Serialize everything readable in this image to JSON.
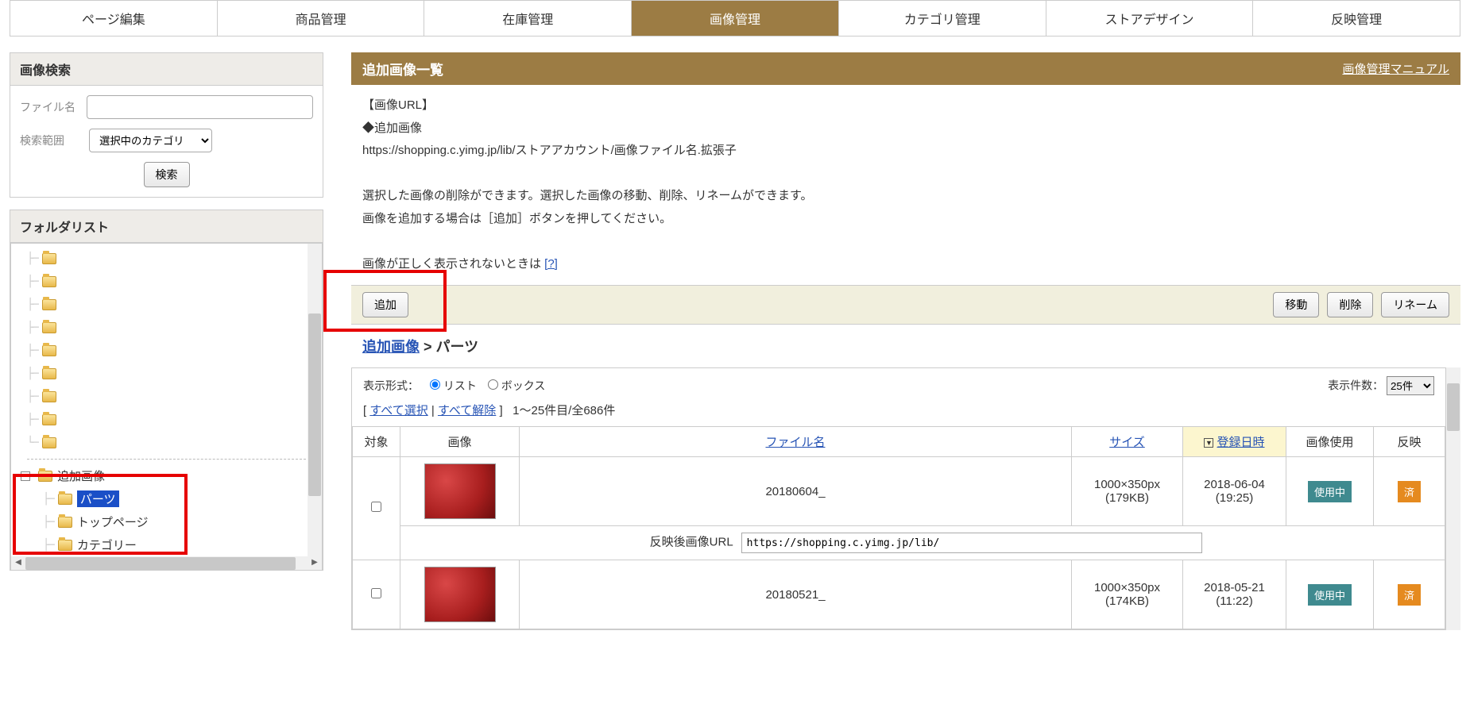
{
  "tabs": [
    "ページ編集",
    "商品管理",
    "在庫管理",
    "画像管理",
    "カテゴリ管理",
    "ストアデザイン",
    "反映管理"
  ],
  "activeTab": 3,
  "search": {
    "title": "画像検索",
    "filename_label": "ファイル名",
    "scope_label": "検索範囲",
    "scope_value": "選択中のカテゴリ",
    "button": "検索"
  },
  "folders": {
    "title": "フォルダリスト",
    "root_added": "追加画像",
    "children": [
      "パーツ",
      "トップページ",
      "カテゴリー"
    ],
    "selected_child": 0
  },
  "main": {
    "header_title": "追加画像一覧",
    "header_link": "画像管理マニュアル",
    "url_heading": "【画像URL】",
    "url_sub": "◆追加画像",
    "url_template": "https://shopping.c.yimg.jp/lib/ストアアカウント/画像ファイル名.拡張子",
    "desc1": "選択した画像の削除ができます。選択した画像の移動、削除、リネームができます。",
    "desc2": "画像を追加する場合は［追加］ボタンを押してください。",
    "desc3_pre": "画像が正しく表示されないときは ",
    "desc3_link": "[?]",
    "btn_add": "追加",
    "btn_move": "移動",
    "btn_delete": "削除",
    "btn_rename": "リネーム",
    "breadcrumb_root": "追加画像",
    "breadcrumb_sep": " > ",
    "breadcrumb_leaf": "パーツ",
    "display_label": "表示形式：",
    "display_list": "リスト",
    "display_box": "ボックス",
    "select_all": "すべて選択",
    "deselect_all": "すべて解除",
    "count_text": "1～25件目/全686件",
    "perpage_label": "表示件数：",
    "perpage_value": "25件",
    "cols": {
      "check": "対象",
      "img": "画像",
      "name": "ファイル名",
      "size": "サイズ",
      "date": "登録日時",
      "use": "画像使用",
      "ref": "反映"
    },
    "rows": [
      {
        "name": "20180604_",
        "size": "1000×350px",
        "kb": "(179KB)",
        "date": "2018-06-04",
        "time": "(19:25)",
        "use": "使用中",
        "ref": "済",
        "url": "https://shopping.c.yimg.jp/lib/"
      },
      {
        "name": "20180521_",
        "size": "1000×350px",
        "kb": "(174KB)",
        "date": "2018-05-21",
        "time": "(11:22)",
        "use": "使用中",
        "ref": "済"
      }
    ],
    "url_row_label": "反映後画像URL"
  }
}
